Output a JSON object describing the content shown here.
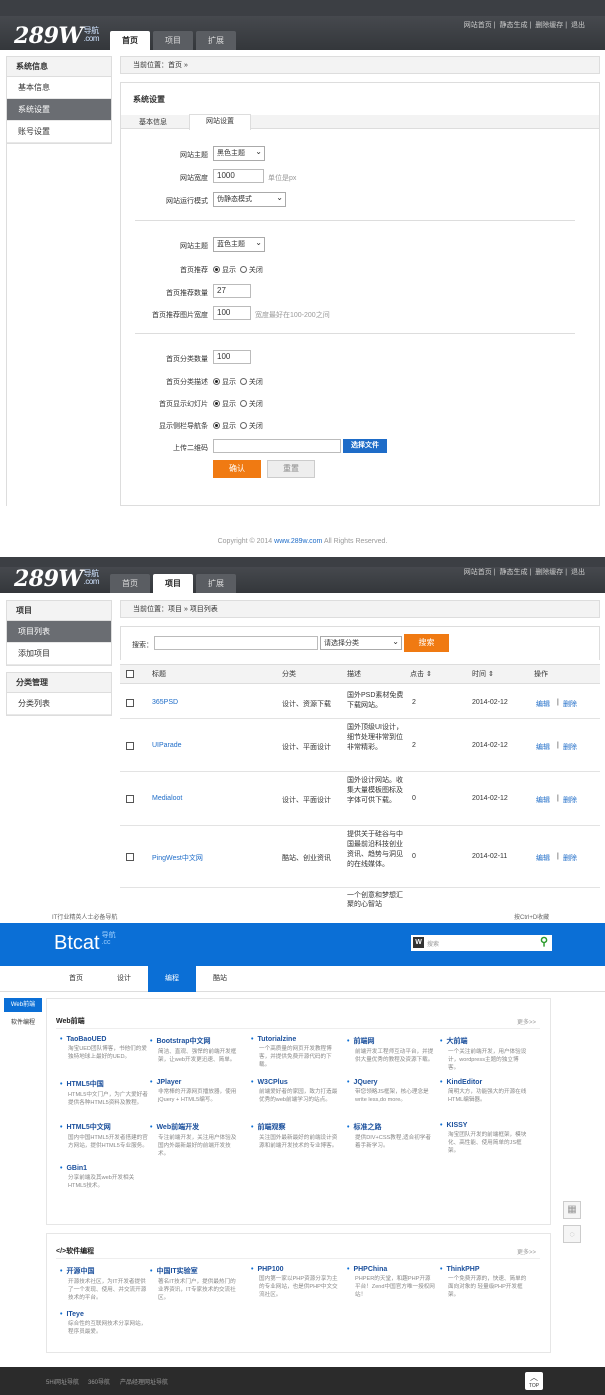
{
  "panel1": {
    "logo": "289W",
    "logo_sub": "导航\n.com",
    "tabs": [
      "首页",
      "项目",
      "扩展"
    ],
    "active_tab": 0,
    "toplinks": [
      "网站首页",
      "静态生成",
      "删除缓存",
      "退出"
    ],
    "sidebar": {
      "head": "系统信息",
      "items": [
        "基本信息",
        "系统设置",
        "账号设置"
      ],
      "active": 1
    },
    "breadcrumb": "当前位置：首页 »",
    "card_title": "系统设置",
    "subtabs": [
      "基本信息",
      "网站设置"
    ],
    "form": {
      "theme_label": "网站主题",
      "theme_value": "黑色主题",
      "width_label": "网站宽度",
      "width_value": "1000",
      "width_hint": "单位是px",
      "mode_label": "网站运行模式",
      "mode_value": "伪静态模式",
      "theme2_label": "网站主题",
      "theme2_value": "蓝色主题",
      "rec_label": "首页推荐",
      "show": "显示",
      "hide": "关闭",
      "rec_count_label": "首页推荐数量",
      "rec_count_value": "27",
      "rec_img_label": "首页推荐图片宽度",
      "rec_img_value": "100",
      "rec_img_hint": "宽度最好在100-200之间",
      "cat_count_label": "首页分类数量",
      "cat_count_value": "100",
      "cat_desc_label": "首页分类描述",
      "slide_label": "首页显示幻灯片",
      "side_nav_label": "显示侧栏导航条",
      "qr_label": "上传二维码",
      "choose_file": "选择文件",
      "confirm": "确认",
      "reset": "重置"
    },
    "copyright": "Copyright © 2014 ",
    "copyright_link": "www.289w.com",
    "copyright_tail": " All Rights Reserved."
  },
  "panel2": {
    "logo": "289W",
    "tabs": [
      "首页",
      "项目",
      "扩展"
    ],
    "active_tab": 1,
    "toplinks": [
      "网站首页",
      "静态生成",
      "删除缓存",
      "退出"
    ],
    "sidebar1": {
      "head": "项目",
      "items": [
        "项目列表",
        "添加项目"
      ],
      "active": 0
    },
    "sidebar2": {
      "head": "分类管理",
      "items": [
        "分类列表"
      ]
    },
    "breadcrumb": "当前位置：项目 » 项目列表",
    "search_label": "搜索：",
    "category_placeholder": "请选择分类",
    "search_button": "搜索",
    "columns": [
      "标题",
      "分类",
      "描述",
      "点击 ⇕",
      "时间 ⇕",
      "操作"
    ],
    "rows": [
      {
        "title": "365PSD",
        "cat": "设计、资源下载",
        "desc": "国外PSD素材免费下载网站。",
        "clicks": "2",
        "date": "2014-02-12"
      },
      {
        "title": "UIParade",
        "cat": "设计、平面设计",
        "desc": "国外顶级UI设计，细节处理非常到位非常精彩。",
        "clicks": "2",
        "date": "2014-02-12"
      },
      {
        "title": "Medialoot",
        "cat": "设计、平面设计",
        "desc": "国外设计网站。收集大量模板图标及字体可供下载。",
        "clicks": "0",
        "date": "2014-02-12"
      },
      {
        "title": "PingWest中文网",
        "cat": "酷站、创业资讯",
        "desc": "提供关于硅谷与中国最前沿科技创业资讯、趋势与洞见的在线媒体。",
        "clicks": "0",
        "date": "2014-02-11"
      }
    ],
    "partial_desc": "一个创意和梦想汇聚的心智站",
    "edit": "编辑",
    "delete": "删除"
  },
  "btcat": {
    "top_left": "IT行业精英人士必备导航",
    "top_right": "按Ctrl+D收藏",
    "logo": "Btcat",
    "logo_sub": "导航\n.cc",
    "search_placeholder": "搜索",
    "search_badge": "W",
    "nav": [
      "首页",
      "设计",
      "编程",
      "酷站"
    ],
    "nav_active": 2,
    "left_tabs": [
      "Web前端",
      "软件编程"
    ],
    "left_active": 0,
    "section1_title": "Web前端",
    "section2_title": "</>软件编程",
    "more": "更多>>",
    "section1": [
      {
        "name": "TaoBaoUED",
        "desc": "淘宝UED团队博客，书他们的爱独特地球上最好的UED。"
      },
      {
        "name": "Bootstrap中文网",
        "desc": "简洁、直观、强悍的前端开发框架，让web开发更迅速、简单。"
      },
      {
        "name": "Tutorialzine",
        "desc": "一个高质量的网页开发教程博客，并提供免费开源代码的下载。"
      },
      {
        "name": "前端网",
        "desc": "前端开发工程师互动平台，并提供大量优秀的教程及资源下载。"
      },
      {
        "name": "大前端",
        "desc": "一个关注前端开发，用户体验设计，wordpress主题的独立博客。"
      },
      {
        "name": "HTML5中国",
        "desc": "HTML5中文门户，为广大爱好者提供各种HTML5资料及教程。"
      },
      {
        "name": "JPlayer",
        "desc": "非常棒的开源网页播放器，使用jQuery + HTML5编写。"
      },
      {
        "name": "W3CPlus",
        "desc": "前端爱好者的家园，致力打造最优秀的web前端学习的站点。"
      },
      {
        "name": "JQuery",
        "desc": "带您领略JS框架，核心理念是write less,do more。"
      },
      {
        "name": "KindEditor",
        "desc": "简明大方，功能强大的开源在线HTML编辑器。"
      },
      {
        "name": "HTML5中文网",
        "desc": "国内中国HTML5开发者搭建的官方网站，提供HTML5专业服务。"
      },
      {
        "name": "Web前端开发",
        "desc": "专注前端开发，关注用户体验及国内外最新最好的前端开发技术。"
      },
      {
        "name": "前端观察",
        "desc": "关注国外最新最好的前端设计资源和前端开发技术的专业博客。"
      },
      {
        "name": "标准之路",
        "desc": "提供DIV+CSS教程,适合初学者着手新学习。"
      },
      {
        "name": "KISSY",
        "desc": "淘宝团队开发的前端框架，模块化、高性能、使用简单的JS框架。"
      },
      {
        "name": "GBin1",
        "desc": "分享前端及其web开发相关HTML5技术。"
      }
    ],
    "section2": [
      {
        "name": "开源中国",
        "desc": "开源技术社区，为IT开发者提供了一个发现、使用、并交流开源技术的平台。"
      },
      {
        "name": "中国IT实验室",
        "desc": "著名IT技术门户，提供最热门的业界资讯，IT专家技术的交流社区。"
      },
      {
        "name": "PHP100",
        "desc": "国内第一家以PHP资源分享为主的专业网站，也是供PHP中文交流社区。"
      },
      {
        "name": "PHPChina",
        "desc": "PHPER的天堂，和趣PHP开源平台！Zend中国官方唯一授权网站！"
      },
      {
        "name": "ThinkPHP",
        "desc": "一个免费开源的，快速、简单的面向对象的 轻量级PHP开发框架。"
      },
      {
        "name": "ITeye",
        "desc": "综合性的互联网技术分享网站，程序员最爱。"
      }
    ],
    "footer_links": [
      "5Hi网址导航",
      "360导航",
      "产品经理网址导航"
    ],
    "top_button": "TOP"
  },
  "colors": {
    "blue": "#0b6fd6",
    "orange": "#f07a12",
    "dark": "#3c3f44"
  }
}
